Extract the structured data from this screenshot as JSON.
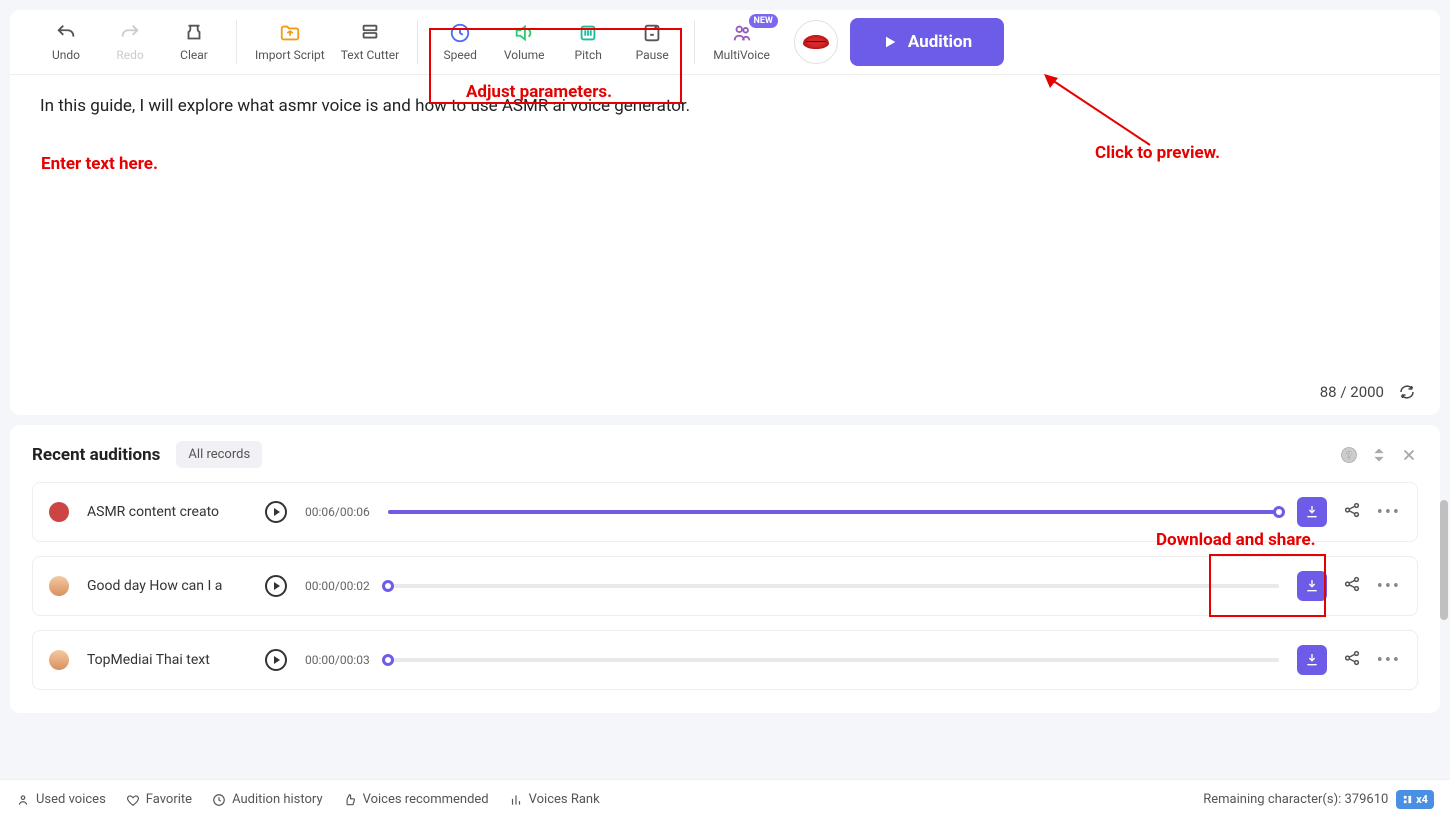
{
  "toolbar": {
    "undo": "Undo",
    "redo": "Redo",
    "clear": "Clear",
    "import": "Import Script",
    "cutter": "Text Cutter",
    "speed": "Speed",
    "volume": "Volume",
    "pitch": "Pitch",
    "pause": "Pause",
    "multivoice": "MultiVoice",
    "new_badge": "NEW",
    "audition_btn": "Audition"
  },
  "editor": {
    "text": "In this guide, I will explore what asmr voice is and how to use ASMR ai voice generator.",
    "count": "88",
    "limit": "2000"
  },
  "auditions": {
    "title": "Recent auditions",
    "all_records": "All records",
    "rows": [
      {
        "name": "ASMR content creato",
        "time": "00:06/00:06",
        "progress": 100
      },
      {
        "name": "Good day How can I a",
        "time": "00:00/00:02",
        "progress": 0
      },
      {
        "name": "TopMediai Thai text",
        "time": "00:00/00:03",
        "progress": 0
      }
    ]
  },
  "footer": {
    "used": "Used voices",
    "favorite": "Favorite",
    "history": "Audition history",
    "recommended": "Voices recommended",
    "rank": "Voices Rank",
    "remaining_label": "Remaining character(s): ",
    "remaining_value": "379610",
    "x4": "x4"
  },
  "annotations": {
    "adjust": "Adjust parameters.",
    "enter": "Enter text here.",
    "preview": "Click to preview.",
    "download": "Download and share."
  }
}
